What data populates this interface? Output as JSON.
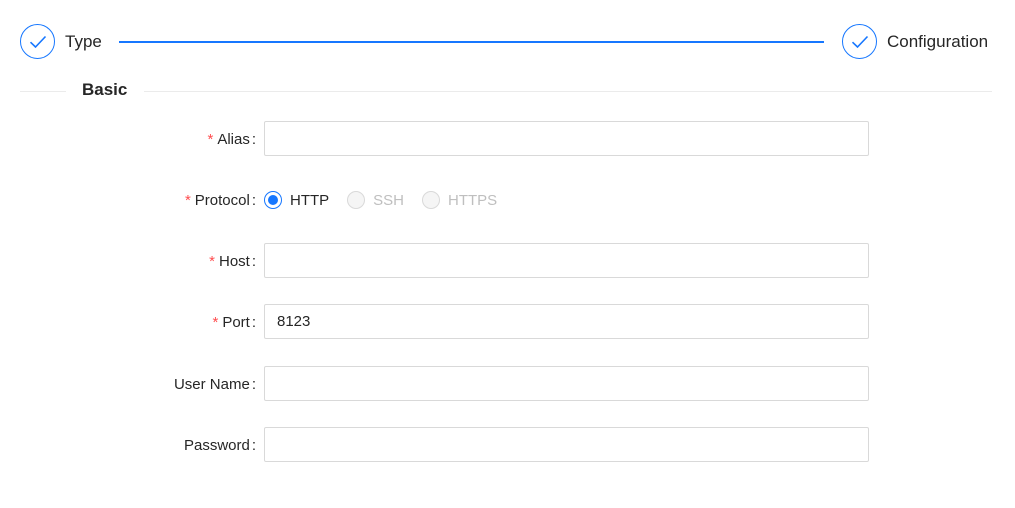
{
  "steps": [
    {
      "title": "Type",
      "status": "finished",
      "icon": "check-icon"
    },
    {
      "title": "Configuration",
      "status": "finished",
      "icon": "check-icon"
    }
  ],
  "section": {
    "title": "Basic"
  },
  "form": {
    "alias": {
      "label": "Alias",
      "required": true,
      "value": ""
    },
    "protocol": {
      "label": "Protocol",
      "required": true,
      "selected": "HTTP",
      "options": [
        {
          "label": "HTTP",
          "checked": true,
          "disabled": false
        },
        {
          "label": "SSH",
          "checked": false,
          "disabled": true
        },
        {
          "label": "HTTPS",
          "checked": false,
          "disabled": true
        }
      ]
    },
    "host": {
      "label": "Host",
      "required": true,
      "value": ""
    },
    "port": {
      "label": "Port",
      "required": true,
      "value": "8123"
    },
    "username": {
      "label": "User Name",
      "required": false,
      "value": ""
    },
    "password": {
      "label": "Password",
      "required": false,
      "value": ""
    },
    "colon": ":",
    "required_mark": "*"
  },
  "colors": {
    "accent": "#1677ff",
    "required": "#ff4d4f",
    "border": "#d9d9d9",
    "disabled_text": "#bfbfbf"
  }
}
